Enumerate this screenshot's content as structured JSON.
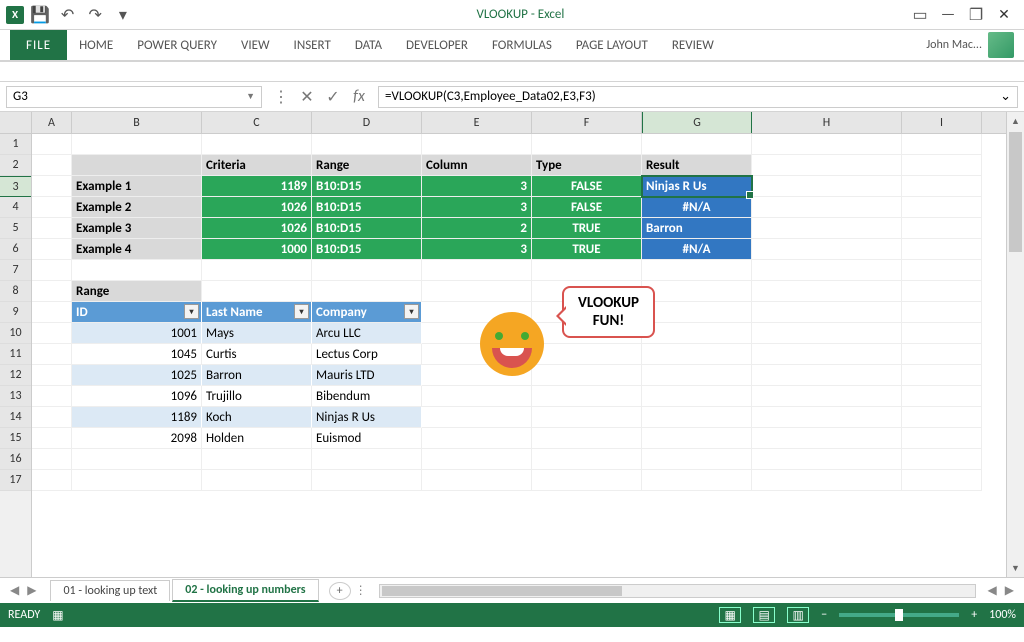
{
  "titlebar": {
    "app": "X",
    "title": "VLOOKUP - Excel"
  },
  "ribbon": {
    "file": "FILE",
    "tabs": [
      "HOME",
      "POWER QUERY",
      "VIEW",
      "INSERT",
      "DATA",
      "DEVELOPER",
      "FORMULAS",
      "PAGE LAYOUT",
      "REVIEW"
    ],
    "user": "John Mac..."
  },
  "fxbar": {
    "name": "G3",
    "formula": "=VLOOKUP(C3,Employee_Data02,E3,F3)",
    "fx": "fx"
  },
  "cols": [
    "A",
    "B",
    "C",
    "D",
    "E",
    "F",
    "G",
    "H",
    "I"
  ],
  "rows": [
    "1",
    "2",
    "3",
    "4",
    "5",
    "6",
    "7",
    "8",
    "9",
    "10",
    "11",
    "12",
    "13",
    "14",
    "15",
    "16",
    "17"
  ],
  "sel": {
    "col": "G",
    "row": "3"
  },
  "headers": {
    "B": "",
    "C": "Criteria",
    "D": "Range",
    "E": "Column",
    "F": "Type",
    "G": "Result"
  },
  "examples": [
    {
      "label": "Example 1",
      "criteria": "1189",
      "range": "B10:D15",
      "col": "3",
      "type": "FALSE",
      "result": "Ninjas R Us"
    },
    {
      "label": "Example 2",
      "criteria": "1026",
      "range": "B10:D15",
      "col": "3",
      "type": "FALSE",
      "result": "#N/A"
    },
    {
      "label": "Example 3",
      "criteria": "1026",
      "range": "B10:D15",
      "col": "2",
      "type": "TRUE",
      "result": "Barron"
    },
    {
      "label": "Example 4",
      "criteria": "1000",
      "range": "B10:D15",
      "col": "3",
      "type": "TRUE",
      "result": "#N/A"
    }
  ],
  "range_label": "Range",
  "table": {
    "cols": [
      "ID",
      "Last Name",
      "Company"
    ],
    "rows": [
      {
        "id": "1001",
        "last": "Mays",
        "company": "Arcu LLC"
      },
      {
        "id": "1045",
        "last": "Curtis",
        "company": "Lectus Corp"
      },
      {
        "id": "1025",
        "last": "Barron",
        "company": "Mauris LTD"
      },
      {
        "id": "1096",
        "last": "Trujillo",
        "company": "Bibendum"
      },
      {
        "id": "1189",
        "last": "Koch",
        "company": "Ninjas R Us"
      },
      {
        "id": "2098",
        "last": "Holden",
        "company": "Euismod"
      }
    ]
  },
  "callout": {
    "line1": "VLOOKUP",
    "line2": "FUN!"
  },
  "sheets": {
    "prev": "01 - looking up text",
    "active": "02 - looking up numbers"
  },
  "status": {
    "ready": "READY",
    "zoom": "100%"
  }
}
